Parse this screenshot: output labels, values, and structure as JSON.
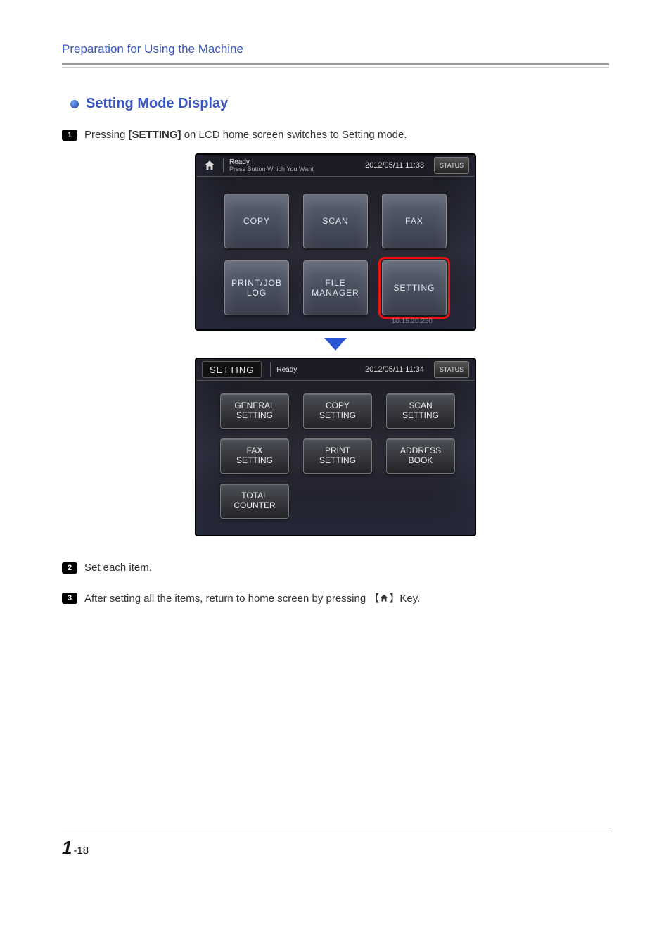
{
  "header": {
    "chapter_title": "Preparation for Using the Machine"
  },
  "section": {
    "title": "Setting Mode Display"
  },
  "steps": {
    "s1_num": "1",
    "s1_pre": "Pressing ",
    "s1_bold": "[SETTING]",
    "s1_post": " on LCD home screen switches to Setting mode.",
    "s2_num": "2",
    "s2_text": "Set each item.",
    "s3_num": "3",
    "s3_pre": "After setting all the items, return to home screen by pressing 【",
    "s3_post": "】Key."
  },
  "home_screen": {
    "ready": "Ready",
    "subready": "Press Button Which You Want",
    "timestamp": "2012/05/11 11:33",
    "status": "STATUS",
    "tiles": {
      "copy": "COPY",
      "scan": "SCAN",
      "fax": "FAX",
      "printjob": "PRINT/JOB\nLOG",
      "filemgr": "FILE\nMANAGER",
      "setting": "SETTING"
    },
    "ip": "10.15.20.250"
  },
  "setting_screen": {
    "tab": "SETTING",
    "ready": "Ready",
    "timestamp": "2012/05/11 11:34",
    "status": "STATUS",
    "btns": {
      "general": "GENERAL\nSETTING",
      "copy": "COPY\nSETTING",
      "scan": "SCAN\nSETTING",
      "fax": "FAX\nSETTING",
      "print": "PRINT\nSETTING",
      "address": "ADDRESS\nBOOK",
      "total": "TOTAL\nCOUNTER"
    }
  },
  "footer": {
    "big": "1",
    "rest": "-18"
  }
}
